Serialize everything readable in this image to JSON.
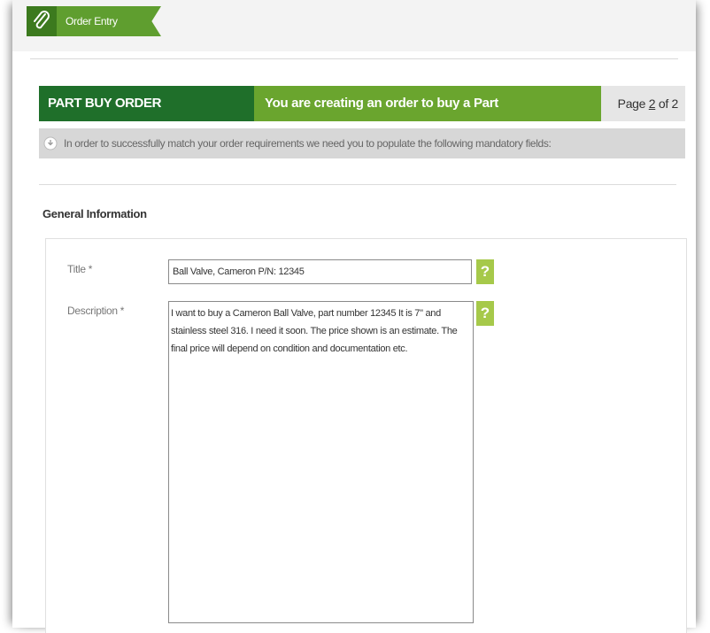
{
  "tab": {
    "label": "Order Entry",
    "icon": "paperclip-icon"
  },
  "header": {
    "title": "PART BUY ORDER",
    "subtitle": "You are creating an order to buy a Part",
    "page_prefix": "Page ",
    "page_current": "2",
    "page_suffix": " of 2"
  },
  "info": {
    "text": "In order to successfully match your order requirements we need you to populate the following mandatory fields:"
  },
  "section": {
    "title": "General Information"
  },
  "form": {
    "title_label": "Title *",
    "title_value": "Ball Valve, Cameron P/N: 12345",
    "description_label": "Description *",
    "description_value": "I want to buy a Cameron Ball Valve, part number 12345 It is 7\" and stainless steel 316. I need it soon. The price shown is an estimate. The final price will depend on condition and documentation etc.",
    "help_symbol": "?"
  },
  "colors": {
    "dark_green": "#1f6f2a",
    "green": "#6aa52e",
    "help_green": "#a6c94a"
  }
}
